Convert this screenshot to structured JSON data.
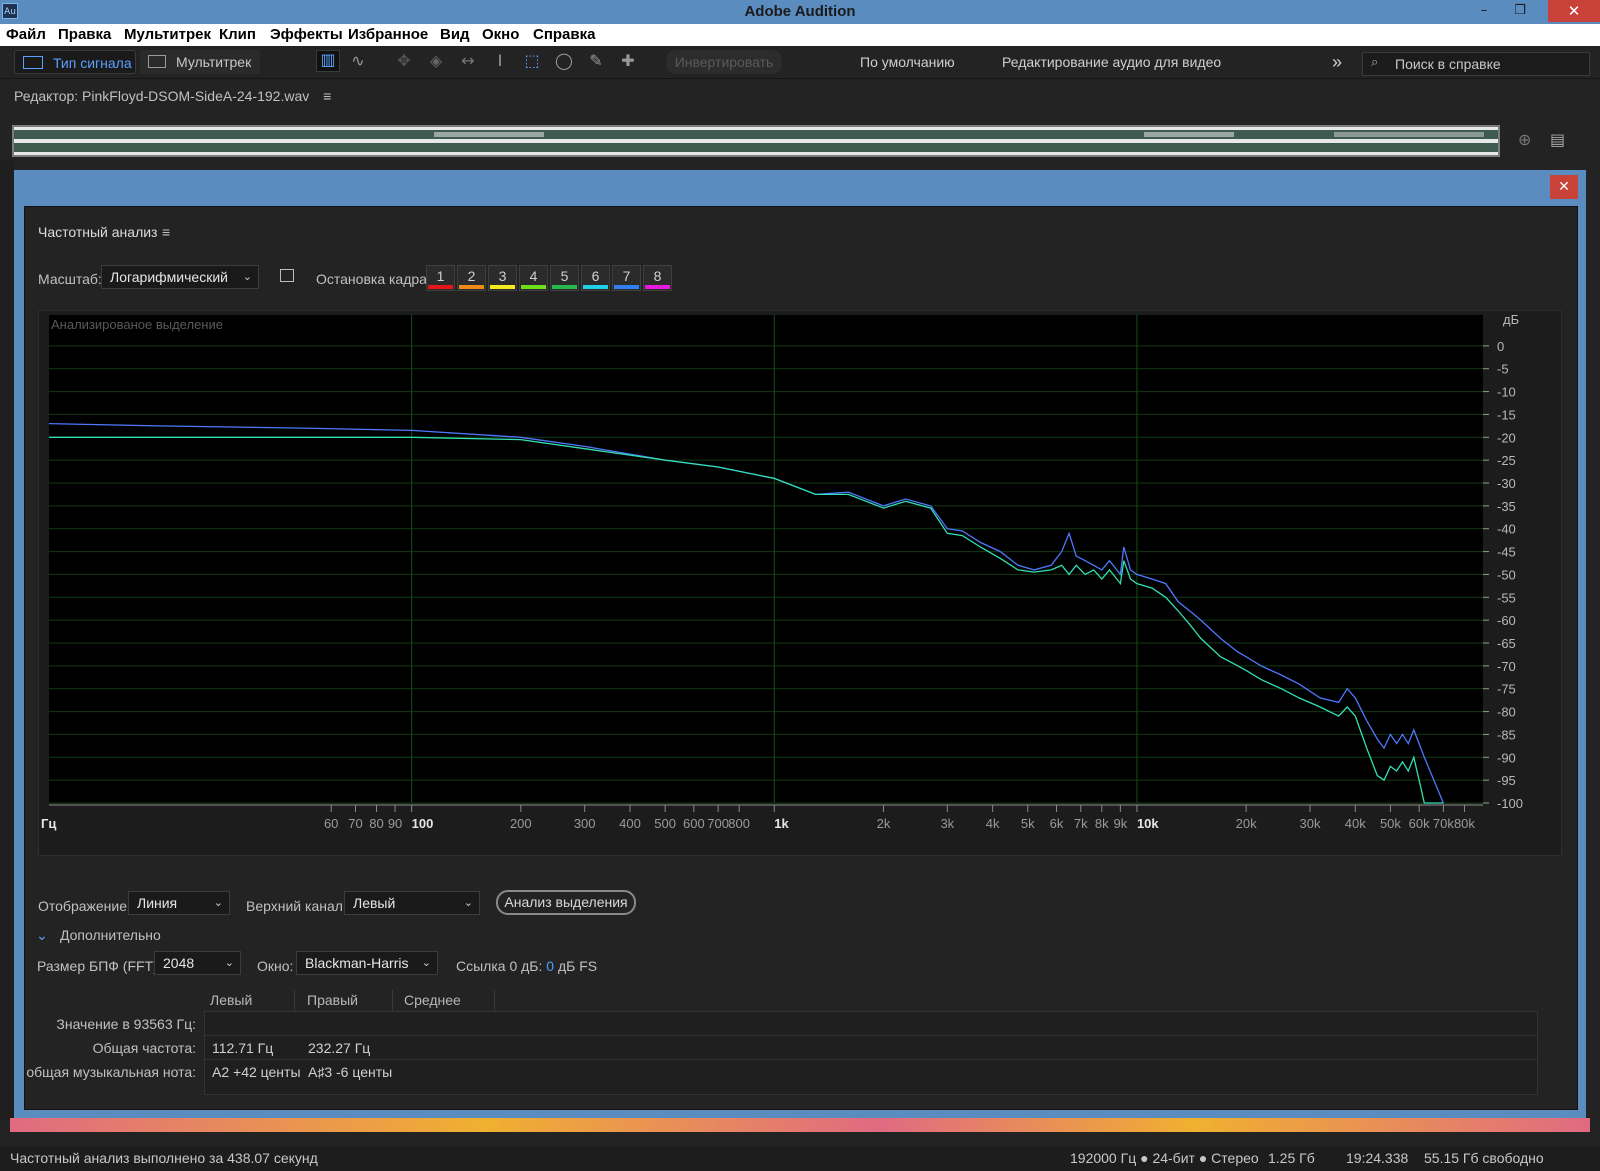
{
  "window": {
    "title": "Adobe Audition",
    "app_icon": "Au",
    "minimize": "–",
    "restore": "❐",
    "close": "✕"
  },
  "menu": [
    "Файл",
    "Правка",
    "Мультитрек",
    "Клип",
    "Эффекты",
    "Избранное",
    "Вид",
    "Окно",
    "Справка"
  ],
  "toolbar": {
    "waveform_tab": "Тип сигнала",
    "multitrack_tab": "Мультитрек",
    "invert_button": "Инвертировать",
    "workspace_default": "По умолчанию",
    "workspace_video": "Редактирование аудио для видео",
    "more": "»",
    "search_placeholder": "Поиск в справке"
  },
  "editor": {
    "title": "Редактор: PinkFloyd-DSOM-SideA-24-192.wav",
    "menu_icon": "≡"
  },
  "dialog": {
    "close": "✕",
    "panel_title": "Частотный анализ",
    "panel_menu_icon": "≡",
    "scale_label": "Масштаб:",
    "scale_value": "Логарифмический",
    "freeze_label": "Остановка кадра:",
    "frames": [
      {
        "label": "1",
        "color": "#e8141a"
      },
      {
        "label": "2",
        "color": "#f08a16"
      },
      {
        "label": "3",
        "color": "#f2ec1a"
      },
      {
        "label": "4",
        "color": "#6ee01a"
      },
      {
        "label": "5",
        "color": "#26b84a"
      },
      {
        "label": "6",
        "color": "#20d0e8"
      },
      {
        "label": "7",
        "color": "#2f7ff0"
      },
      {
        "label": "8",
        "color": "#e81ae0"
      }
    ],
    "display_label": "Отображение:",
    "display_value": "Линия",
    "top_channel_label": "Верхний канал:",
    "top_channel_value": "Левый",
    "analyze_button": "Анализ выделения",
    "advanced_label": "Дополнительно",
    "fft_label": "Размер БПФ (FFT):",
    "fft_value": "2048",
    "window_label": "Окно:",
    "window_value": "Blackman-Harris",
    "ref_label": "Ссылка 0 дБ:",
    "ref_value": "0",
    "ref_unit": "дБ FS",
    "table": {
      "headers": [
        "Левый",
        "Правый",
        "Среднее"
      ],
      "rows": [
        {
          "label": "Значение в 93563 Гц:",
          "left": "",
          "right": ""
        },
        {
          "label": "Общая частота:",
          "left": "112.71 Гц",
          "right": "232.27 Гц"
        },
        {
          "label": "общая музыкальная нота:",
          "left": "A2 +42 центы",
          "right": "A♯3 -6 центы"
        }
      ]
    }
  },
  "chart_data": {
    "type": "line",
    "title": "Анализированое выделение",
    "xlabel": "Гц",
    "ylabel": "дБ",
    "xscale": "log",
    "xlim": [
      10,
      90000
    ],
    "ylim": [
      -100,
      5
    ],
    "grid": true,
    "x_ticks": [
      {
        "value": 60,
        "label": "60"
      },
      {
        "value": 70,
        "label": "70"
      },
      {
        "value": 80,
        "label": "80"
      },
      {
        "value": 90,
        "label": "90"
      },
      {
        "value": 100,
        "label": "100"
      },
      {
        "value": 200,
        "label": "200"
      },
      {
        "value": 300,
        "label": "300"
      },
      {
        "value": 400,
        "label": "400"
      },
      {
        "value": 500,
        "label": "500"
      },
      {
        "value": 600,
        "label": "600"
      },
      {
        "value": 700,
        "label": "700"
      },
      {
        "value": 800,
        "label": "800"
      },
      {
        "value": 1000,
        "label": "1k"
      },
      {
        "value": 2000,
        "label": "2k"
      },
      {
        "value": 3000,
        "label": "3k"
      },
      {
        "value": 4000,
        "label": "4k"
      },
      {
        "value": 5000,
        "label": "5k"
      },
      {
        "value": 6000,
        "label": "6k"
      },
      {
        "value": 7000,
        "label": "7k"
      },
      {
        "value": 8000,
        "label": "8k"
      },
      {
        "value": 9000,
        "label": "9k"
      },
      {
        "value": 10000,
        "label": "10k"
      },
      {
        "value": 20000,
        "label": "20k"
      },
      {
        "value": 30000,
        "label": "30k"
      },
      {
        "value": 40000,
        "label": "40k"
      },
      {
        "value": 50000,
        "label": "50k"
      },
      {
        "value": 60000,
        "label": "60k"
      },
      {
        "value": 70000,
        "label": "70k"
      },
      {
        "value": 80000,
        "label": "80k"
      }
    ],
    "y_ticks": [
      0,
      -5,
      -10,
      -15,
      -20,
      -25,
      -30,
      -35,
      -40,
      -45,
      -50,
      -55,
      -60,
      -65,
      -70,
      -75,
      -80,
      -85,
      -90,
      -95,
      -100
    ],
    "series": [
      {
        "color": "#4f78ff",
        "x": [
          10,
          20,
          50,
          100,
          200,
          300,
          500,
          700,
          1000,
          1300,
          1600,
          2000,
          2300,
          2700,
          3000,
          3300,
          3700,
          4200,
          4700,
          5200,
          5800,
          6200,
          6500,
          6800,
          7200,
          7600,
          8000,
          8400,
          9000,
          9200,
          9600,
          10000,
          11000,
          12000,
          13000,
          14000,
          15000,
          17000,
          19000,
          20000,
          22000,
          25000,
          28000,
          32000,
          36000,
          38000,
          40000,
          43000,
          46000,
          48000,
          50000,
          52000,
          54000,
          56000,
          58000,
          60000,
          62000,
          70000
        ],
        "y": [
          -17,
          -17.5,
          -18,
          -18.5,
          -20,
          -22,
          -25,
          -26.5,
          -29,
          -32.5,
          -32,
          -35,
          -33.5,
          -35,
          -40,
          -40.5,
          -43,
          -45,
          -48,
          -49,
          -48,
          -45,
          -41,
          -46,
          -47,
          -48,
          -49,
          -47,
          -50,
          -44,
          -49,
          -50,
          -51,
          -52,
          -56,
          -58,
          -60,
          -64,
          -67,
          -68,
          -70,
          -72,
          -74,
          -77,
          -78,
          -75,
          -77,
          -82,
          -86,
          -88,
          -85,
          -87,
          -85,
          -87,
          -84,
          -87,
          -90,
          -100
        ]
      },
      {
        "color": "#32e0b4",
        "x": [
          10,
          20,
          50,
          100,
          200,
          300,
          500,
          700,
          1000,
          1300,
          1600,
          2000,
          2300,
          2700,
          3000,
          3300,
          3700,
          4200,
          4700,
          5200,
          5800,
          6200,
          6500,
          6800,
          7200,
          7600,
          8000,
          8400,
          9000,
          9200,
          9600,
          10000,
          11000,
          12000,
          13000,
          14000,
          15000,
          17000,
          19000,
          20000,
          22000,
          25000,
          28000,
          32000,
          36000,
          38000,
          40000,
          43000,
          46000,
          48000,
          50000,
          52000,
          54000,
          56000,
          58000,
          60000,
          62000,
          70000
        ],
        "y": [
          -20,
          -20,
          -20,
          -20,
          -20.5,
          -22.5,
          -25,
          -26.5,
          -29,
          -32.5,
          -32.5,
          -35.5,
          -34,
          -35.5,
          -41,
          -41.5,
          -44,
          -46.5,
          -49,
          -49.5,
          -49,
          -48,
          -50,
          -48,
          -50,
          -49,
          -51,
          -49,
          -52,
          -47,
          -51,
          -52,
          -53,
          -55,
          -58,
          -61,
          -64,
          -68,
          -70,
          -71,
          -73,
          -75,
          -77,
          -79,
          -81,
          -79,
          -81,
          -88,
          -94,
          -95,
          -92,
          -93,
          -91,
          -93,
          -90,
          -95,
          -100,
          -101
        ]
      }
    ]
  },
  "status": {
    "left": "Частотный анализ выполнено за 438.07 секунд",
    "format": "192000 Гц ● 24-бит ● Стерео",
    "size": "1.25 Гб",
    "duration": "19:24.338",
    "free": "55.15 Гб свободно"
  }
}
